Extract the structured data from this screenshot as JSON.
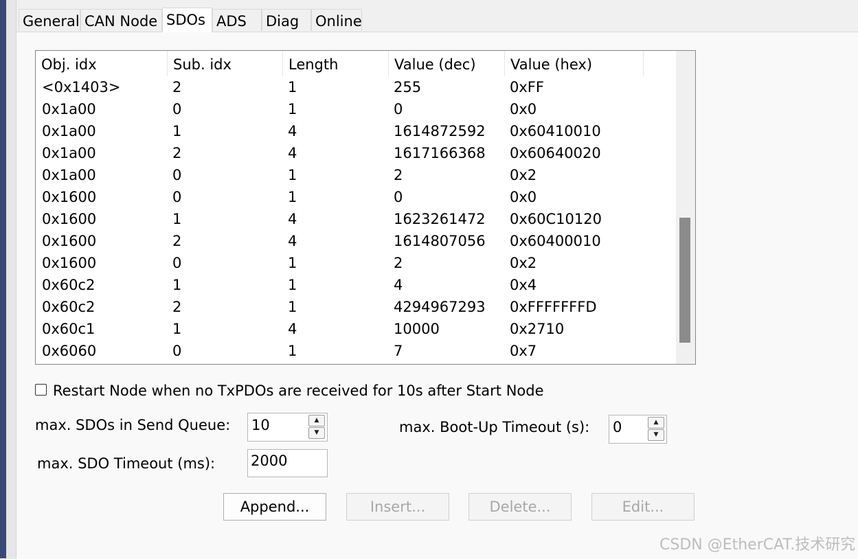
{
  "tabs": [
    "General",
    "CAN Node",
    "SDOs",
    "ADS",
    "Diag",
    "Online"
  ],
  "active_tab": "SDOs",
  "table": {
    "columns": [
      "Obj. idx",
      "Sub. idx",
      "Length",
      "Value (dec)",
      "Value (hex)"
    ],
    "rows": [
      [
        "<0x1403>",
        "2",
        "1",
        "255",
        "0xFF"
      ],
      [
        "0x1a00",
        "0",
        "1",
        "0",
        "0x0"
      ],
      [
        "0x1a00",
        "1",
        "4",
        "1614872592",
        "0x60410010"
      ],
      [
        "0x1a00",
        "2",
        "4",
        "1617166368",
        "0x60640020"
      ],
      [
        "0x1a00",
        "0",
        "1",
        "2",
        "0x2"
      ],
      [
        "0x1600",
        "0",
        "1",
        "0",
        "0x0"
      ],
      [
        "0x1600",
        "1",
        "4",
        "1623261472",
        "0x60C10120"
      ],
      [
        "0x1600",
        "2",
        "4",
        "1614807056",
        "0x60400010"
      ],
      [
        "0x1600",
        "0",
        "1",
        "2",
        "0x2"
      ],
      [
        "0x60c2",
        "1",
        "1",
        "4",
        "0x4"
      ],
      [
        "0x60c2",
        "2",
        "1",
        "4294967293",
        "0xFFFFFFFD"
      ],
      [
        "0x60c1",
        "1",
        "4",
        "10000",
        "0x2710"
      ],
      [
        "0x6060",
        "0",
        "1",
        "7",
        "0x7"
      ]
    ]
  },
  "options": {
    "restart_node_label": "Restart Node when no TxPDOs are received for 10s after Start Node",
    "restart_node_checked": false,
    "max_sdos_label": "max. SDOs in Send Queue:",
    "max_sdos_value": "10",
    "max_bootup_label": "max. Boot-Up Timeout (s):",
    "max_bootup_value": "0",
    "max_sdo_timeout_label": "max. SDO Timeout (ms):",
    "max_sdo_timeout_value": "2000"
  },
  "buttons": {
    "append": "Append...",
    "insert": "Insert...",
    "delete": "Delete...",
    "edit": "Edit..."
  },
  "watermark": "CSDN @EtherCAT.技术研究"
}
